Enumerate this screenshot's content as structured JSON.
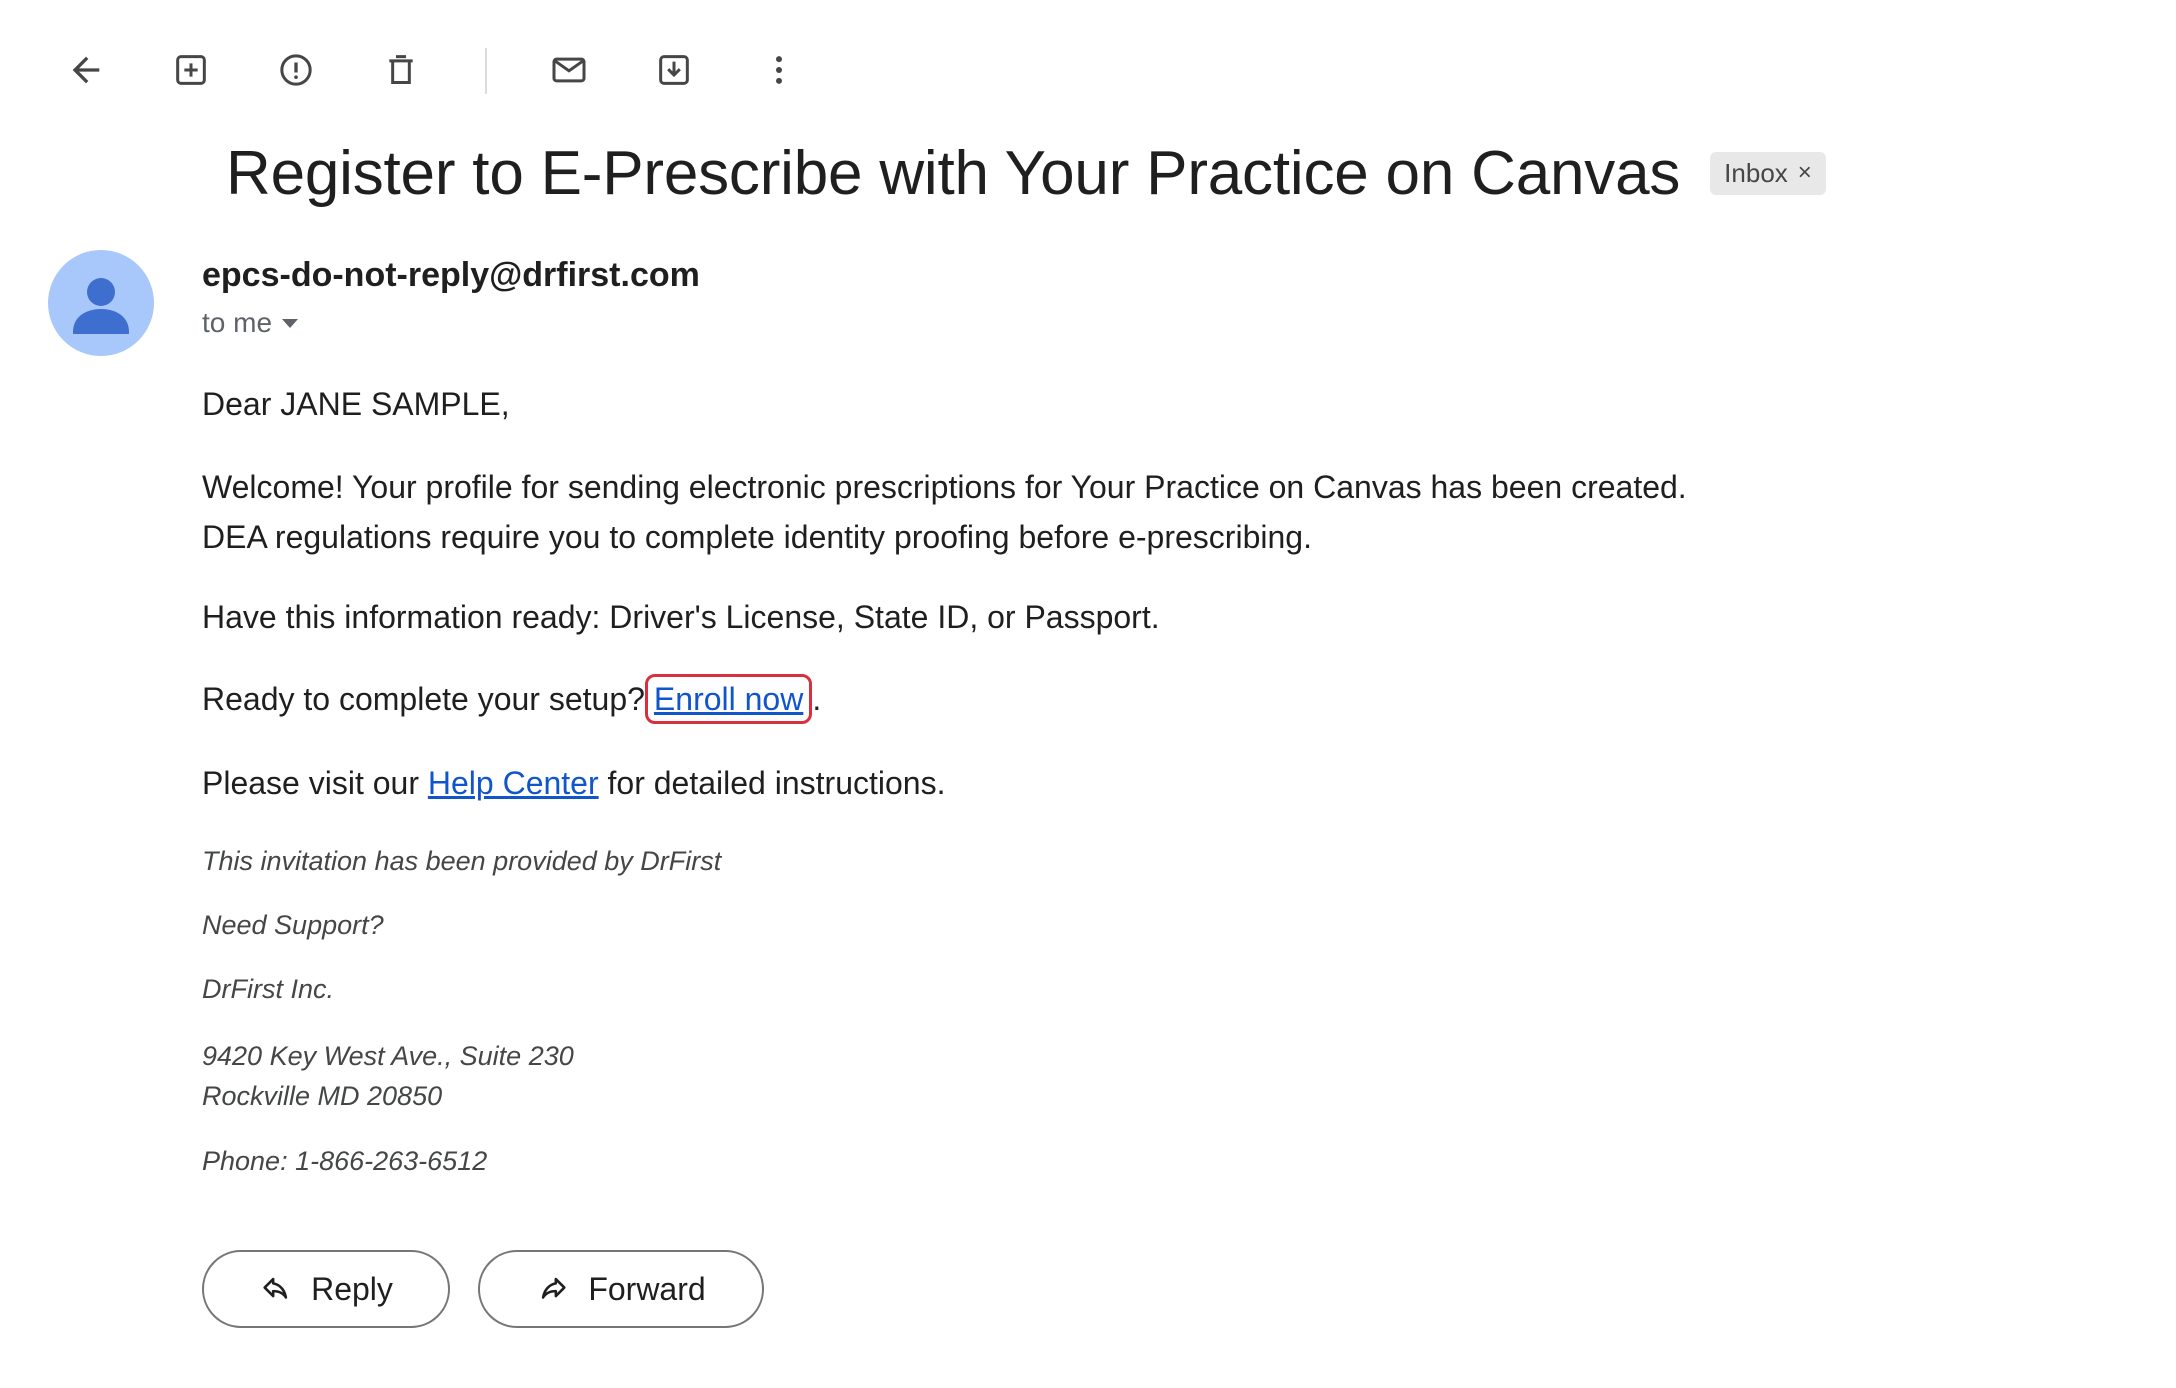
{
  "toolbar": {
    "icons": [
      "back-arrow-icon",
      "add-to-tasks-icon",
      "report-spam-icon",
      "delete-icon",
      "mark-unread-icon",
      "move-to-icon",
      "more-options-icon"
    ]
  },
  "email": {
    "subject": "Register to E-Prescribe with Your Practice on Canvas",
    "label": "Inbox",
    "label_close": "×",
    "sender": "epcs-do-not-reply@drfirst.com",
    "recipient": "to me"
  },
  "body": {
    "greeting": "Dear JANE SAMPLE,",
    "welcome_line1": "Welcome! Your profile for sending electronic prescriptions for Your Practice on Canvas has been created.",
    "welcome_line2": "DEA regulations require you to complete identity proofing before e-prescribing.",
    "info_ready": "Have this information ready: Driver's License, State ID, or Passport.",
    "setup_prefix": "Ready to complete your setup?",
    "enroll_link": "Enroll now",
    "setup_suffix": ".",
    "help_prefix": "Please visit our ",
    "help_link": "Help Center",
    "help_suffix": " for detailed instructions."
  },
  "footer": {
    "provided_by": "This invitation has been provided by DrFirst",
    "need_support": "Need Support?",
    "company": "DrFirst Inc.",
    "address_line1": "9420 Key West Ave., Suite 230",
    "address_line2": "Rockville MD 20850",
    "phone": "Phone: 1-866-263-6512"
  },
  "actions": {
    "reply": "Reply",
    "forward": "Forward"
  },
  "colors": {
    "link": "#1155cc",
    "highlight": "#d93040",
    "avatar_bg": "#a8c7fa",
    "avatar_fg": "#3f6fce"
  }
}
